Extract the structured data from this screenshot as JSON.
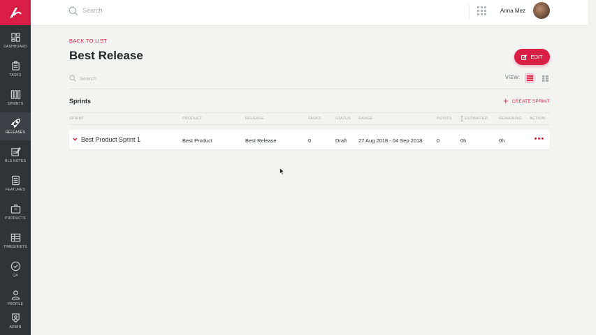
{
  "header": {
    "search_placeholder": "Search",
    "user_name": "Anna Mez"
  },
  "sidebar": {
    "items": [
      {
        "label": "DASHBOARD",
        "icon": "dashboard-icon"
      },
      {
        "label": "TASKS",
        "icon": "tasks-icon"
      },
      {
        "label": "SPRINTS",
        "icon": "sprints-icon"
      },
      {
        "label": "RELEASES",
        "icon": "rocket-icon",
        "active": true
      },
      {
        "label": "RLS NOTES",
        "icon": "notes-icon"
      },
      {
        "label": "FEATURES",
        "icon": "features-icon"
      },
      {
        "label": "PRODUCTS",
        "icon": "products-icon"
      },
      {
        "label": "TIMESHEETS",
        "icon": "timesheets-icon"
      },
      {
        "label": "QA",
        "icon": "check-circle-icon"
      },
      {
        "label": "PROFILE",
        "icon": "user-icon"
      },
      {
        "label": "ADMIN",
        "icon": "badge-icon"
      }
    ]
  },
  "page": {
    "back_link": "BACK TO LIST",
    "title": "Best Release",
    "edit_label": "EDIT",
    "search_placeholder": "Search",
    "view_label": "VIEW:"
  },
  "sprints": {
    "title": "Sprints",
    "create_label": "CREATE SPRINT",
    "columns": [
      "SPRINT",
      "PRODUCT",
      "RELEASE",
      "TASKS",
      "STATUS",
      "RANGE",
      "POINTS",
      "ESTIMATED",
      "REMAINING",
      "ACTION"
    ],
    "rows": [
      {
        "sprint": "Best Product Sprint 1",
        "product": "Best Product",
        "release": "Best Release",
        "tasks": "0",
        "status": "Draft",
        "range": "27 Aug 2018 - 04 Sep 2018",
        "points": "0",
        "estimated": "0h",
        "remaining": "0h"
      }
    ]
  },
  "colors": {
    "accent": "#d81e44",
    "sidebar": "#2f3437",
    "background": "#f3f4f2"
  }
}
